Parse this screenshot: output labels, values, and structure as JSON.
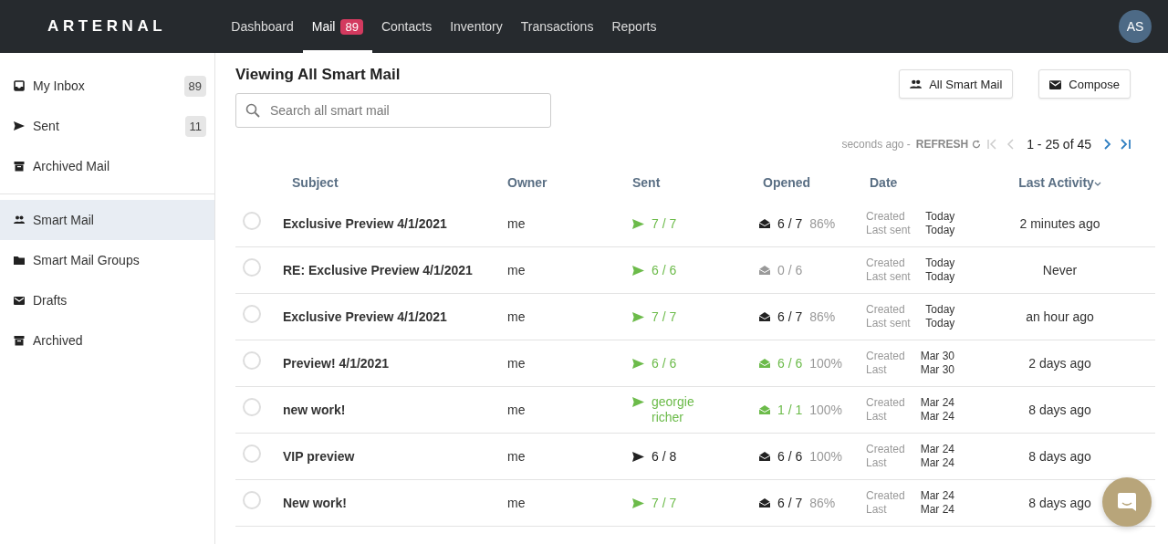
{
  "header": {
    "logo": "ARTERNAL",
    "nav": [
      {
        "label": "Dashboard",
        "selected": false
      },
      {
        "label": "Mail",
        "selected": true,
        "badge": "89"
      },
      {
        "label": "Contacts",
        "selected": false
      },
      {
        "label": "Inventory",
        "selected": false
      },
      {
        "label": "Transactions",
        "selected": false
      },
      {
        "label": "Reports",
        "selected": false
      }
    ],
    "avatar": "AS"
  },
  "sidebar": {
    "groups": [
      [
        {
          "label": "My Inbox",
          "kind": "inbox",
          "count": "89",
          "selected": false
        },
        {
          "label": "Sent",
          "kind": "send",
          "count": "11",
          "selected": false
        },
        {
          "label": "Archived Mail",
          "kind": "archive",
          "selected": false
        }
      ],
      [
        {
          "label": "Smart Mail",
          "kind": "people",
          "selected": true
        },
        {
          "label": "Smart Mail Groups",
          "kind": "folder",
          "selected": false
        },
        {
          "label": "Drafts",
          "kind": "mail",
          "selected": false
        },
        {
          "label": "Archived",
          "kind": "archive",
          "selected": false
        }
      ]
    ]
  },
  "main": {
    "title": "Viewing All Smart Mail",
    "search": {
      "placeholder": "Search all smart mail"
    },
    "buttons": [
      {
        "label": "All Smart Mail",
        "kind": "people"
      },
      {
        "label": "Compose",
        "kind": "mail"
      }
    ],
    "refresh": {
      "text": "seconds ago - ",
      "action": "REFRESH"
    },
    "pagination": "1 - 25 of 45",
    "table": {
      "columns": [
        "Subject",
        "Owner",
        "Sent",
        "Opened",
        "Date",
        "Last Activity"
      ],
      "rows": [
        {
          "selected": false,
          "subject": "Exclusive Preview 4/1/2021",
          "owner": "me",
          "sent": {
            "text": "7 / 7",
            "kind": "all"
          },
          "opened": {
            "text": "6 / 7",
            "kind": "some"
          },
          "percent": "86%",
          "created_label": "Created",
          "created": "Today",
          "last_label": "Last sent",
          "last": "Today",
          "activity": "2 minutes ago"
        },
        {
          "selected": false,
          "subject": "RE: Exclusive Preview 4/1/2021",
          "owner": "me",
          "sent": {
            "text": "6 / 6",
            "kind": "all"
          },
          "opened": {
            "text": "0 / 6",
            "kind": "none"
          },
          "created_label": "Created",
          "created": "Today",
          "last_label": "Last sent",
          "last": "Today",
          "activity": "Never"
        },
        {
          "selected": false,
          "subject": "Exclusive Preview 4/1/2021",
          "owner": "me",
          "sent": {
            "text": "7 / 7",
            "kind": "all"
          },
          "opened": {
            "text": "6 / 7",
            "kind": "some"
          },
          "percent": "86%",
          "created_label": "Created",
          "created": "Today",
          "last_label": "Last sent",
          "last": "Today",
          "activity": "an hour ago"
        },
        {
          "selected": false,
          "subject": "Preview! 4/1/2021",
          "owner": "me",
          "sent": {
            "text": "6 / 6",
            "kind": "all"
          },
          "opened": {
            "text": "6 / 6",
            "kind": "all"
          },
          "percent": "100%",
          "created_label": "Created",
          "created": "Mar 30",
          "last_label": "Last",
          "last": "Mar 30",
          "activity": "2 days ago"
        },
        {
          "selected": false,
          "subject": "new work!",
          "owner": "me",
          "sent": {
            "text": "georgie richer",
            "kind": "all"
          },
          "opened": {
            "text": "1 / 1",
            "kind": "all"
          },
          "percent": "100%",
          "created_label": "Created",
          "created": "Mar 24",
          "last_label": "Last",
          "last": "Mar 24",
          "activity": "8 days ago"
        },
        {
          "selected": false,
          "subject": "VIP preview",
          "owner": "me",
          "sent": {
            "text": "6 / 8",
            "kind": "some"
          },
          "opened": {
            "text": "6 / 6",
            "kind": "some"
          },
          "percent": "100%",
          "created_label": "Created",
          "created": "Mar 24",
          "last_label": "Last",
          "last": "Mar 24",
          "activity": "8 days ago"
        },
        {
          "selected": false,
          "subject": "New work!",
          "owner": "me",
          "sent": {
            "text": "7 / 7",
            "kind": "all"
          },
          "opened": {
            "text": "6 / 7",
            "kind": "some"
          },
          "percent": "86%",
          "created_label": "Created",
          "created": "Mar 24",
          "last_label": "Last",
          "last": "Mar 24",
          "activity": "8 days ago"
        }
      ]
    }
  }
}
